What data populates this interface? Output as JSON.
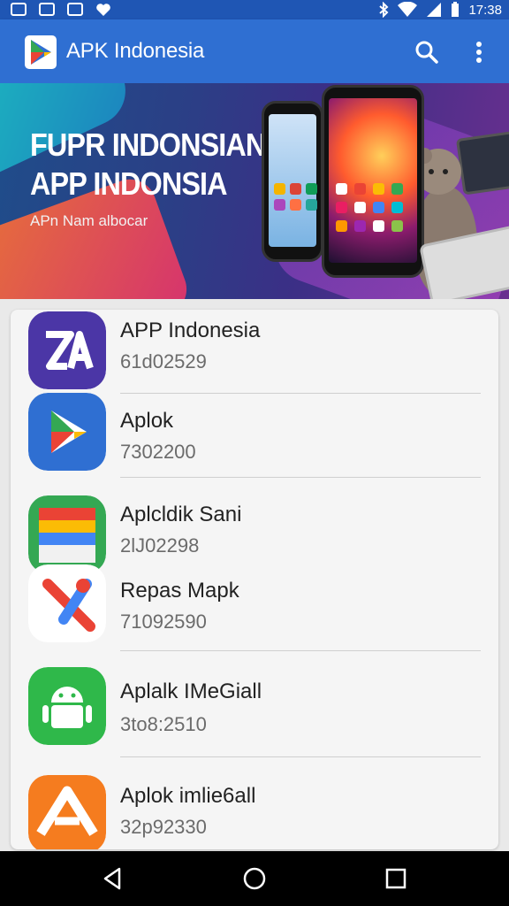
{
  "status_bar": {
    "time": "17:38"
  },
  "app_bar": {
    "title": "APK Indonesia",
    "search_icon": "search-icon",
    "more_icon": "more-vert-icon"
  },
  "banner": {
    "heading_line1": "FUPR INDONSIAN",
    "heading_line2": "APP INDONSIA",
    "subtitle": "APn Nam albocar"
  },
  "apps": [
    {
      "name": "APP Indonesia",
      "code": "61d02529",
      "icon": "app-indonesia-icon",
      "colors": [
        "#5b3fb0",
        "#3b2d8f"
      ]
    },
    {
      "name": "Aplok",
      "code": "7302200",
      "icon": "play-store-icon",
      "colors": [
        "#2f6fd2",
        "#1d4ea8"
      ]
    },
    {
      "name": "Aplcldik Sani",
      "code": "2lJ02298",
      "icon": "folder-icon",
      "colors": [
        "#34a853",
        "#fbbc05"
      ]
    },
    {
      "name": "Repas Mapk",
      "code": "71092590",
      "icon": "repair-tool-icon",
      "colors": [
        "#ffffff",
        "#ea4335"
      ]
    },
    {
      "name": "Aplalk IMeGiall",
      "code": "3to8:2510",
      "icon": "android-icon",
      "colors": [
        "#2fb84a",
        "#1e9a38"
      ]
    },
    {
      "name": "Aplok imlie6all",
      "code": "32p92330",
      "icon": "app-a-icon",
      "colors": [
        "#f57c1f",
        "#e55a10"
      ]
    }
  ],
  "nav_bar": {
    "back_icon": "back-icon",
    "home_icon": "home-icon",
    "recents_icon": "recents-icon"
  }
}
